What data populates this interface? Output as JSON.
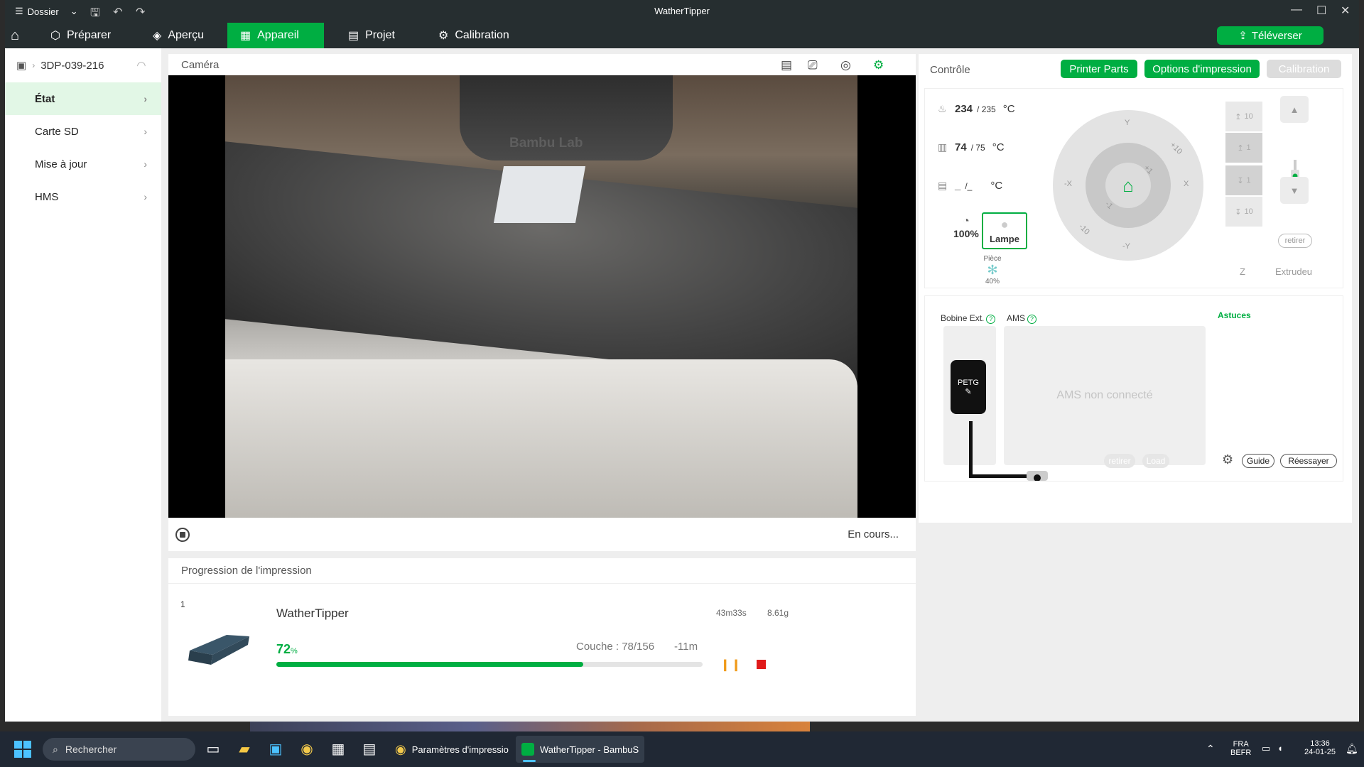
{
  "titlebar": {
    "menu_label": "Dossier",
    "title": "WatherTipper"
  },
  "nav": {
    "items": [
      {
        "label": "Préparer",
        "icon": "cube-icon"
      },
      {
        "label": "Aperçu",
        "icon": "layers-icon"
      },
      {
        "label": "Appareil",
        "icon": "device-icon",
        "active": true
      },
      {
        "label": "Projet",
        "icon": "document-icon"
      },
      {
        "label": "Calibration",
        "icon": "gear-icon"
      }
    ],
    "upload_label": "Téléverser"
  },
  "sidebar": {
    "printer_name": "3DP-039-216",
    "items": [
      {
        "label": "État",
        "active": true
      },
      {
        "label": "Carte SD"
      },
      {
        "label": "Mise à jour"
      },
      {
        "label": "HMS"
      }
    ]
  },
  "camera": {
    "title": "Caméra",
    "status": "En cours...",
    "overlay_text": "Bambu Lab"
  },
  "progress": {
    "title": "Progression de l'impression",
    "plate_number": "1",
    "job_name": "WatherTipper",
    "time": "43m33s",
    "weight": "8.61g",
    "percent": "72",
    "percent_unit": "%",
    "percent_value": 72,
    "layer": "Couche : 78/156",
    "remaining": "-11m"
  },
  "control": {
    "title": "Contrôle",
    "buttons": {
      "printer_parts": "Printer Parts",
      "print_options": "Options d'impression",
      "calibration": "Calibration"
    },
    "nozzle": {
      "current": "234",
      "target": "/ 235",
      "unit": "°C"
    },
    "bed": {
      "current": "74",
      "target": "/ 75",
      "unit": "°C"
    },
    "chamber": {
      "current": "_",
      "target": "/_",
      "unit": "°C"
    },
    "speed": "100%",
    "lamp_label": "Lampe",
    "fan": {
      "label": "Pièce",
      "value": "40%"
    },
    "jog_labels": {
      "y": "Y",
      "minus_y": "-Y",
      "x": "X",
      "minus_x": "-X",
      "plus10": "+10",
      "plus1": "+1",
      "minus1": "-1",
      "minus10": "-10"
    },
    "z_buttons": [
      "10",
      "1",
      "1",
      "10"
    ],
    "z_label": "Z",
    "extruder_label": "Extrudeu",
    "extruder_retire": "retirer",
    "filament": {
      "external_label": "Bobine Ext.",
      "ams_label": "AMS",
      "tips": "Astuces",
      "spool_material": "PETG",
      "ams_status": "AMS non connecté",
      "buttons": {
        "retire": "retirer",
        "load": "Load",
        "guide": "Guide",
        "retry": "Réessayer"
      }
    }
  },
  "taskbar": {
    "search_placeholder": "Rechercher",
    "windows": [
      {
        "label": "Paramètres d'impressio"
      },
      {
        "label": "WatherTipper - BambuS",
        "active": true
      }
    ],
    "lang": "FRA",
    "layout": "BEFR",
    "time": "13:36",
    "date": "24-01-25"
  },
  "colors": {
    "accent": "#00ae42",
    "titlebar": "#262e30",
    "stop": "#e01a1a",
    "pause": "#f09a19"
  }
}
